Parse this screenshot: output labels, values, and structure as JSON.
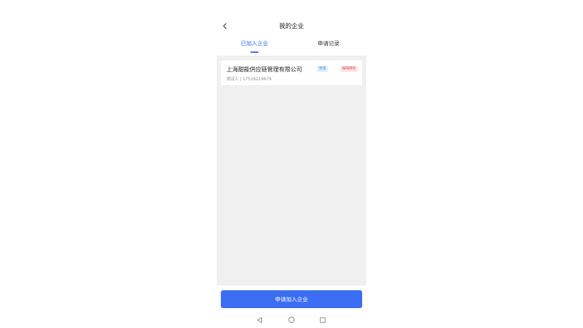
{
  "header": {
    "title": "我的企业",
    "back_icon": "chevron-left-icon"
  },
  "tabs": [
    {
      "label": "已加入企业",
      "active": true
    },
    {
      "label": "申请记录",
      "active": false
    }
  ],
  "companies": [
    {
      "name": "上海甜能供应链管理有限公司",
      "role_tag": "管理",
      "status_tag": "解除绑定",
      "contact": "测试人 | 17516219679"
    }
  ],
  "footer": {
    "apply_label": "申请加入企业"
  },
  "system_nav": {
    "icons": [
      "triangle-back-icon",
      "circle-home-icon",
      "square-recent-icon"
    ]
  },
  "colors": {
    "accent": "#3b6ef3",
    "tab_active": "#3a6ee8",
    "content_bg": "#f0f0f0",
    "status_red": "#e04848"
  }
}
